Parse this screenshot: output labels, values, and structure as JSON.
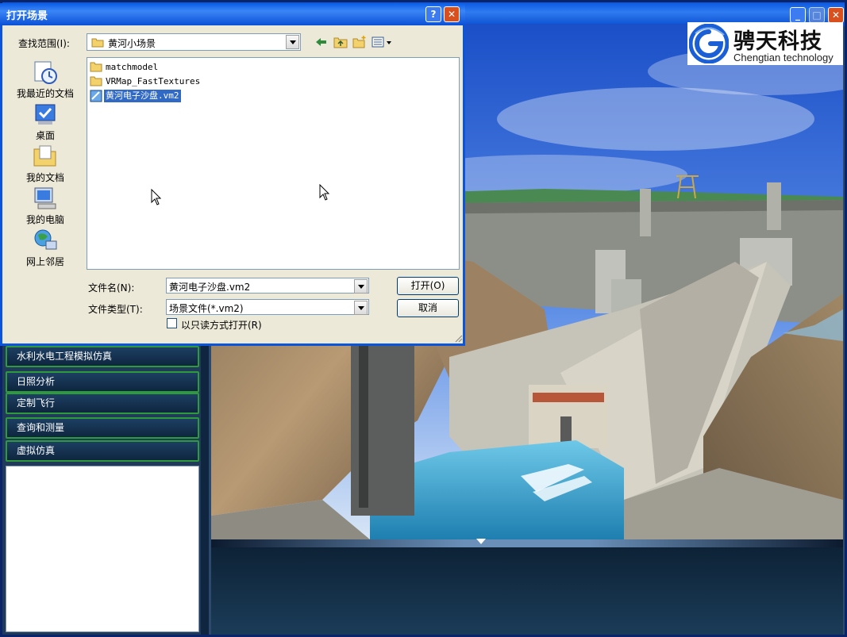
{
  "main_window": {
    "controls": {
      "minimize": "_",
      "maximize": "□",
      "close": "✕"
    }
  },
  "logo": {
    "name_cn": "骋天科技",
    "name_en": "Chengtian technology",
    "color": "#1a5fd6"
  },
  "dialog": {
    "title": "打开场景",
    "help": "?",
    "close": "✕",
    "look_in_label": "查找范围(I):",
    "look_in_value": "黄河小场景",
    "toolbar": [
      "back-icon",
      "up-folder-icon",
      "new-folder-icon",
      "view-menu-icon"
    ],
    "places": [
      {
        "label": "我最近的文档",
        "icon": "recent-documents-icon"
      },
      {
        "label": "桌面",
        "icon": "desktop-icon"
      },
      {
        "label": "我的文档",
        "icon": "my-documents-icon"
      },
      {
        "label": "我的电脑",
        "icon": "my-computer-icon"
      },
      {
        "label": "网上邻居",
        "icon": "network-places-icon"
      }
    ],
    "files": [
      {
        "name": "matchmodel",
        "type": "folder"
      },
      {
        "name": "VRMap_FastTextures",
        "type": "folder"
      },
      {
        "name": "黄河电子沙盘.vm2",
        "type": "scene-file",
        "selected": true
      }
    ],
    "file_name_label": "文件名(N):",
    "file_name_value": "黄河电子沙盘.vm2",
    "file_type_label": "文件类型(T):",
    "file_type_value": "场景文件(*.vm2)",
    "readonly_label": "以只读方式打开(R)",
    "readonly_checked": false,
    "open_button": "打开(O)",
    "cancel_button": "取消"
  },
  "left_panel": {
    "items": [
      {
        "label": "水利水电工程模拟仿真"
      },
      {
        "label": "日照分析"
      },
      {
        "label": "定制飞行"
      },
      {
        "label": "查询和测量"
      },
      {
        "label": "虚拟仿真"
      }
    ],
    "border_color": "#2e9a3c"
  }
}
